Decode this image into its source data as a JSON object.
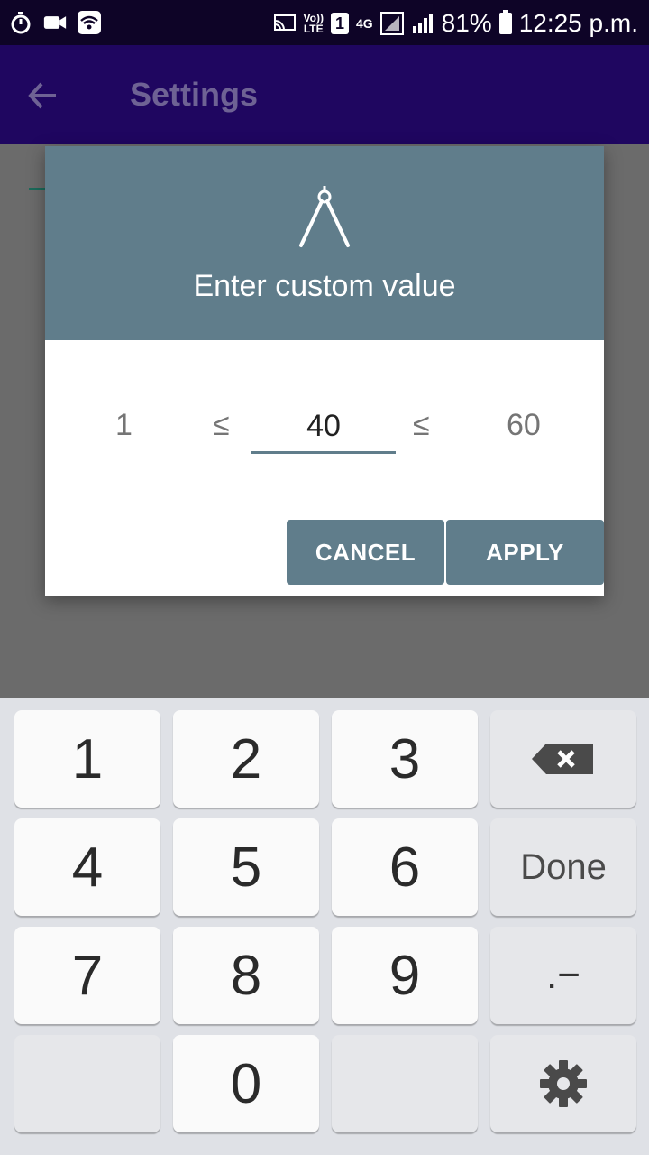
{
  "status_bar": {
    "volte_top": "Vo))",
    "volte_bottom": "LTE",
    "sim_slot": "1",
    "network_type": "4G",
    "battery": "81%",
    "time": "12:25 p.m."
  },
  "app_bar": {
    "title": "Settings"
  },
  "dialog": {
    "title": "Enter custom value",
    "min": "1",
    "le_symbol": "≤",
    "value": "40",
    "max": "60",
    "cancel_label": "CANCEL",
    "apply_label": "APPLY"
  },
  "keyboard": {
    "keys": [
      "1",
      "2",
      "3",
      "4",
      "5",
      "6",
      "7",
      "8",
      "9",
      "0"
    ],
    "done_label": "Done",
    "dot_dash_label": ".−"
  },
  "colors": {
    "status_bar": "#0e0427",
    "app_bar_dimmed": "#1f0660",
    "dialog_accent": "#607d8b",
    "keyboard_bg": "#dfe1e6"
  }
}
